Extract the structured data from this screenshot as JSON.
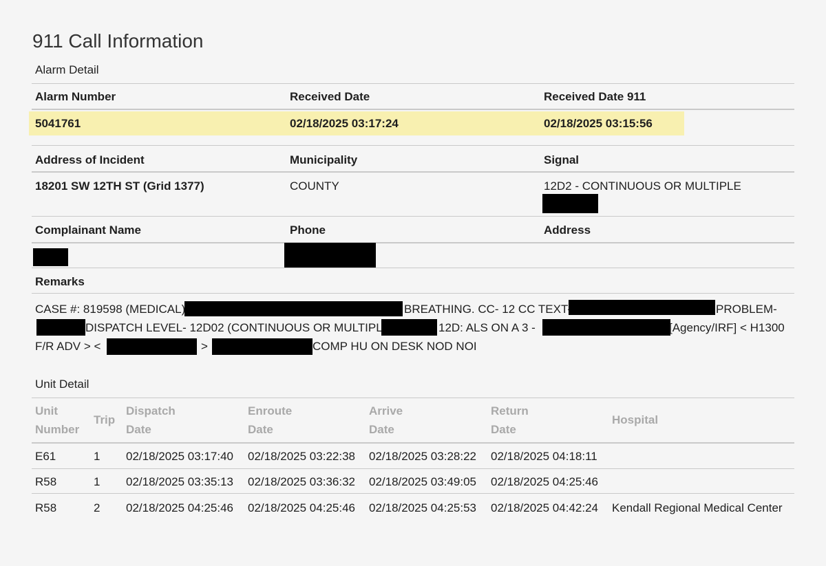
{
  "title": "911 Call Information",
  "alarm_section": {
    "label": "Alarm Detail",
    "headers": [
      "Alarm Number",
      "Received Date",
      "Received Date 911"
    ],
    "values": [
      "5041761",
      "02/18/2025 03:17:24",
      "02/18/2025 03:15:56"
    ],
    "highlight_color": "#f8f0b0"
  },
  "incident": {
    "headers": [
      "Address of Incident",
      "Municipality",
      "Signal"
    ],
    "address": "18201 SW 12TH ST (Grid 1377)",
    "municipality": "COUNTY",
    "signal": "12D2 - CONTINUOUS OR MULTIPLE"
  },
  "complainant": {
    "headers": [
      "Complainant Name",
      "Phone",
      "Address"
    ]
  },
  "remarks": {
    "label": "Remarks",
    "line1": [
      "CASE #: 819598 (MEDICAL)",
      "BREATHING. CC- 12 CC TEXT-",
      "PROBLEM-"
    ],
    "line2": [
      "DISPATCH LEVEL- 12D02 (CONTINUOUS OR MULTIPLE",
      "12D: ALS ON A 3 -",
      "[Agency/IRF] < H1300"
    ],
    "line3": [
      "F/R ADV > <",
      ">",
      "COMP HU ON DESK NOD NOI"
    ]
  },
  "unit_section": {
    "label": "Unit Detail",
    "columns": [
      {
        "l1": "Unit",
        "l2": "Number"
      },
      {
        "l1": "Trip",
        "l2": ""
      },
      {
        "l1": "Dispatch",
        "l2": "Date"
      },
      {
        "l1": "Enroute",
        "l2": "Date"
      },
      {
        "l1": "Arrive",
        "l2": "Date"
      },
      {
        "l1": "Return",
        "l2": "Date"
      },
      {
        "l1": "Hospital",
        "l2": ""
      }
    ],
    "rows": [
      [
        "E61",
        "1",
        "02/18/2025 03:17:40",
        "02/18/2025 03:22:38",
        "02/18/2025 03:28:22",
        "02/18/2025 04:18:11",
        ""
      ],
      [
        "R58",
        "1",
        "02/18/2025 03:35:13",
        "02/18/2025 03:36:32",
        "02/18/2025 03:49:05",
        "02/18/2025 04:25:46",
        ""
      ],
      [
        "R58",
        "2",
        "02/18/2025 04:25:46",
        "02/18/2025 04:25:46",
        "02/18/2025 04:25:53",
        "02/18/2025 04:42:24",
        "Kendall Regional Medical Center"
      ]
    ]
  }
}
